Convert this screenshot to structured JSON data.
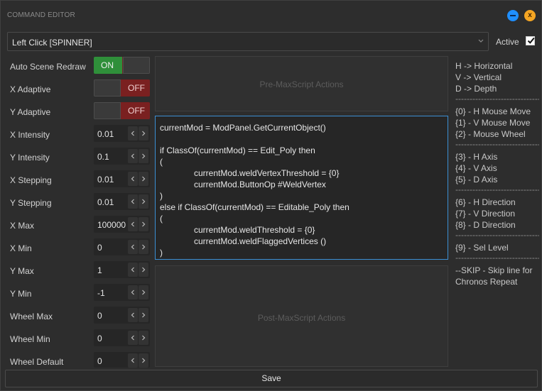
{
  "window": {
    "title": "COMMAND EDITOR",
    "close_glyph": "x"
  },
  "command_select": {
    "value": "Left Click [SPINNER]"
  },
  "active": {
    "label": "Active",
    "checked": true
  },
  "properties": {
    "auto_scene_redraw": {
      "label": "Auto Scene Redraw",
      "state": "ON"
    },
    "x_adaptive": {
      "label": "X Adaptive",
      "state": "OFF"
    },
    "y_adaptive": {
      "label": "Y Adaptive",
      "state": "OFF"
    },
    "x_intensity": {
      "label": "X Intensity",
      "value": "0.01"
    },
    "y_intensity": {
      "label": "Y Intensity",
      "value": "0.1"
    },
    "x_stepping": {
      "label": "X Stepping",
      "value": "0.01"
    },
    "y_stepping": {
      "label": "Y Stepping",
      "value": "0.01"
    },
    "x_max": {
      "label": "X Max",
      "value": "100000"
    },
    "x_min": {
      "label": "X Min",
      "value": "0"
    },
    "y_max": {
      "label": "Y Max",
      "value": "1"
    },
    "y_min": {
      "label": "Y Min",
      "value": "-1"
    },
    "wheel_max": {
      "label": "Wheel Max",
      "value": "0"
    },
    "wheel_min": {
      "label": "Wheel Min",
      "value": "0"
    },
    "wheel_default": {
      "label": "Wheel Default",
      "value": "0"
    }
  },
  "pre_actions": {
    "placeholder": "Pre-MaxScript Actions"
  },
  "post_actions": {
    "placeholder": "Post-MaxScript Actions"
  },
  "script": {
    "lines": [
      "currentMod = ModPanel.GetCurrentObject()",
      "",
      "if ClassOf(currentMod) == Edit_Poly then",
      "(",
      "currentMod.weldVertexThreshold = {0}",
      "currentMod.ButtonOp #WeldVertex",
      ")",
      "else if ClassOf(currentMod) == Editable_Poly then",
      "(",
      "currentMod.weldThreshold = {0}",
      "currentMod.weldFlaggedVertices ()",
      ")"
    ]
  },
  "help": {
    "h_axis_label": "H -> Horizontal",
    "v_axis_label": "V -> Vertical",
    "d_axis_label": "D -> Depth",
    "separator": "-------------------------------",
    "p0": "{0} - H Mouse Move",
    "p1": "{1} - V Mouse Move",
    "p2": "{2} - Mouse Wheel",
    "p3": "{3} - H Axis",
    "p4": "{4} - V Axis",
    "p5": "{5} - D Axis",
    "p6": "{6} - H Direction",
    "p7": "{7} - V Direction",
    "p8": "{8} - D Direction",
    "p9": "{9} - Sel Level",
    "skip_1": "--SKIP - Skip line for",
    "skip_2": "Chronos Repeat"
  },
  "save": {
    "label": "Save"
  },
  "colors": {
    "accent_blue": "#1f8fff",
    "close_orange": "#f5a623",
    "toggle_on": "#2f8f3a",
    "toggle_off": "#7a2020",
    "editor_border": "#3b8fd4"
  }
}
